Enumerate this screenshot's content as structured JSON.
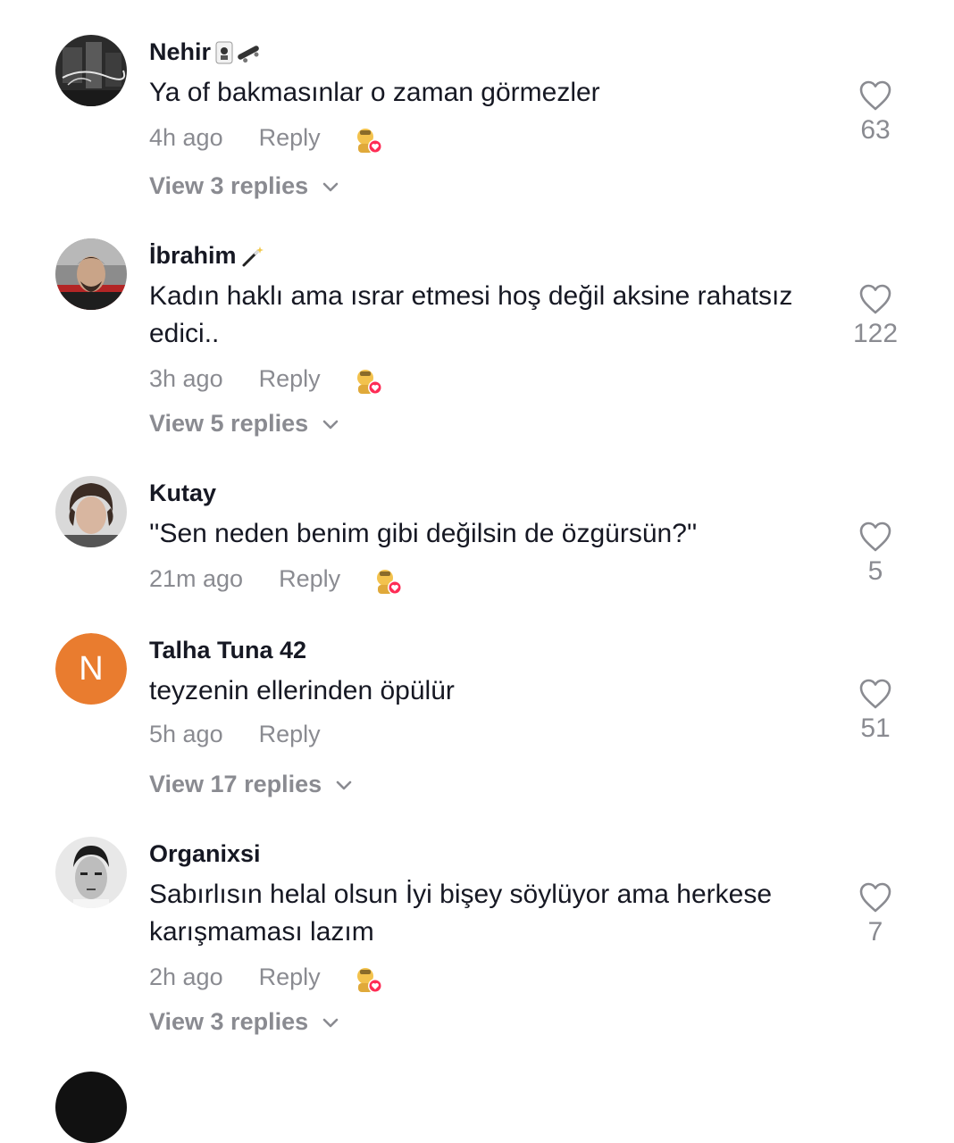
{
  "comments": [
    {
      "username": "Nehir",
      "text": "Ya of bakmasınlar o zaman görmezler",
      "time": "4h ago",
      "reply": "Reply",
      "likes": "63",
      "view_replies": "View 3 replies"
    },
    {
      "username": "İbrahim",
      "text": "Kadın haklı ama ısrar etmesi hoş değil aksine rahatsız edici..",
      "time": "3h ago",
      "reply": "Reply",
      "likes": "122",
      "view_replies": "View 5 replies"
    },
    {
      "username": "Kutay",
      "text": "''Sen neden benim gibi değilsin de özgürsün?''",
      "time": "21m ago",
      "reply": "Reply",
      "likes": "5"
    },
    {
      "username": "Talha Tuna 42",
      "avatar_letter": "N",
      "text": "teyzenin ellerinden öpülür",
      "time": "5h ago",
      "reply": "Reply",
      "likes": "51",
      "view_replies": "View 17 replies"
    },
    {
      "username": "Organixsi",
      "text": "Sabırlısın helal olsun İyi bişey söylüyor ama herkese karışmaması lazım",
      "time": "2h ago",
      "reply": "Reply",
      "likes": "7",
      "view_replies": "View 3 replies"
    }
  ],
  "colors": {
    "text_primary": "#161823",
    "text_secondary": "#8a8b91",
    "avatar_orange": "#e97c2f",
    "creator_like_heart": "#fe2c55"
  },
  "icons": {
    "like": "heart-outline-icon",
    "expand": "chevron-down-icon",
    "creator_liked": "creator-liked-badge-icon"
  }
}
